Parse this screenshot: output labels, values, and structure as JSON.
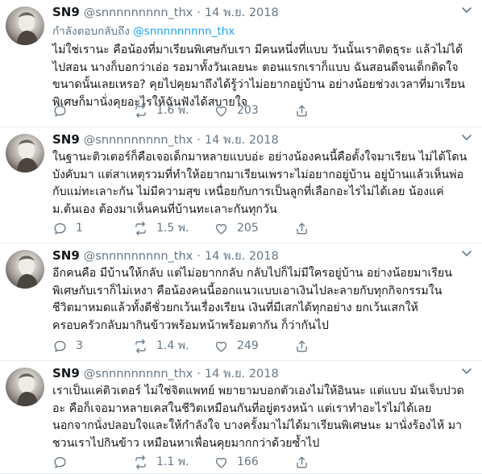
{
  "tweets": [
    {
      "display_name": "SN9",
      "handle": "@snnnnnnnnn_thx",
      "date": "14 พ.ย. 2018",
      "replying_prefix": "กำลังตอบกลับถึง",
      "replying_to": "@snnnnnnnnn_thx",
      "lines": [
        "ไม่ใช่เรานะ คือน้องที่มาเรียนพิเศษกับเรา มีคนหนึ่งที่แบบ วันนั้นเราติดธุระ แล้วไม่ได้",
        "ไปสอน นางก็บอกว่าเอ่อ รอมาทั้งวันเลยนะ ตอนแรกเราก็แบบ ฉันสอนดีจนเด็กติดใจ",
        "ขนาดนั้นเลยเหรอ? คุยไปคุยมาถึงได้รู้ว่าไม่อยากอยู่บ้าน อย่างน้อยช่วงเวลาที่มาเรียน",
        "พิเศษก็มานั่งคุยอะไรให้ฉันฟังได้สบายใจ"
      ],
      "replies": "",
      "retweets": "1.6 พ.",
      "likes": "203"
    },
    {
      "display_name": "SN9",
      "handle": "@snnnnnnnnn_thx",
      "date": "14 พ.ย. 2018",
      "lines": [
        "ในฐานะติวเตอร์ก็คือเจอเด็กมาหลายแบบอ่ะ อย่างน้องคนนี้คือตั้งใจมาเรียน ไม่ได้โดน",
        "บังคับมา แต่สาเหตุรวมที่ทำให้อยากมาเรียนเพราะไม่อยากอยู่บ้าน อยู่บ้านแล้วเห็นพ่อ",
        "กับแม่ทะเลาะกัน ไม่มีความสุข เหนื่อยกับการเป็นลูกที่เลือกอะไรไม่ได้เลย น้องแค่",
        "ม.ต้นเอง ต้องมาเห็นคนที่บ้านทะเลาะกันทุกวัน"
      ],
      "replies": "1",
      "retweets": "1.5 พ.",
      "likes": "205"
    },
    {
      "display_name": "SN9",
      "handle": "@snnnnnnnnn_thx",
      "date": "14 พ.ย. 2018",
      "lines": [
        "อีกคนคือ มีบ้านให้กลับ แต่ไม่อยากกลับ กลับไปก็ไม่มีใครอยู่บ้าน อย่างน้อยมาเรียน",
        "พิเศษกับเราก็ไม่เหงา คือน้องคนนี้ออกแนวแบบเอาเงินไปละลายกับทุกกิจกรรมใน",
        "ชีวิตมาหมดแล้วทั้งดีชั่วยกเว้นเรื่องเรียน เงินที่มีเสกได้ทุกอย่าง ยกเว้นเสกให้",
        "ครอบครัวกลับมากินข้าวพร้อมหน้าพร้อมตากัน ก็ว่ากันไป"
      ],
      "replies": "3",
      "retweets": "1.4 พ.",
      "likes": "249"
    },
    {
      "display_name": "SN9",
      "handle": "@snnnnnnnnn_thx",
      "date": "14 พ.ย. 2018",
      "lines": [
        "เราเป็นแค่ติวเตอร์ ไม่ใช่จิตแพทย์ พยายามบอกตัวเองไม่ให้อินนะ แต่แบบ มันเจ็บปวด",
        "อะ คือก็เจอมาหลายเคสในชีวิตเหมือนกันที่อยู่ตรงหน้า แต่เราทำอะไรไม่ได้เลย",
        "นอกจากนั่งปลอบใจและให้กำลังใจ บางครั้งมาไม่ได้มาเรียนพิเศษนะ มานั่งร้องไห้ มา",
        "ชวนเราไปกินข้าว เหมือนหาเพื่อนคุยมากกว่าด้วยซ้ำไป"
      ],
      "replies": "",
      "retweets": "1.1 พ.",
      "likes": "166"
    }
  ],
  "icons": {
    "reply": "reply-icon",
    "retweet": "retweet-icon",
    "like": "heart-icon",
    "share": "share-icon",
    "more": "chevron-down-icon"
  },
  "colors": {
    "text": "#14171a",
    "muted": "#657786",
    "link": "#1da1f2",
    "divider": "#e6ecf0"
  }
}
